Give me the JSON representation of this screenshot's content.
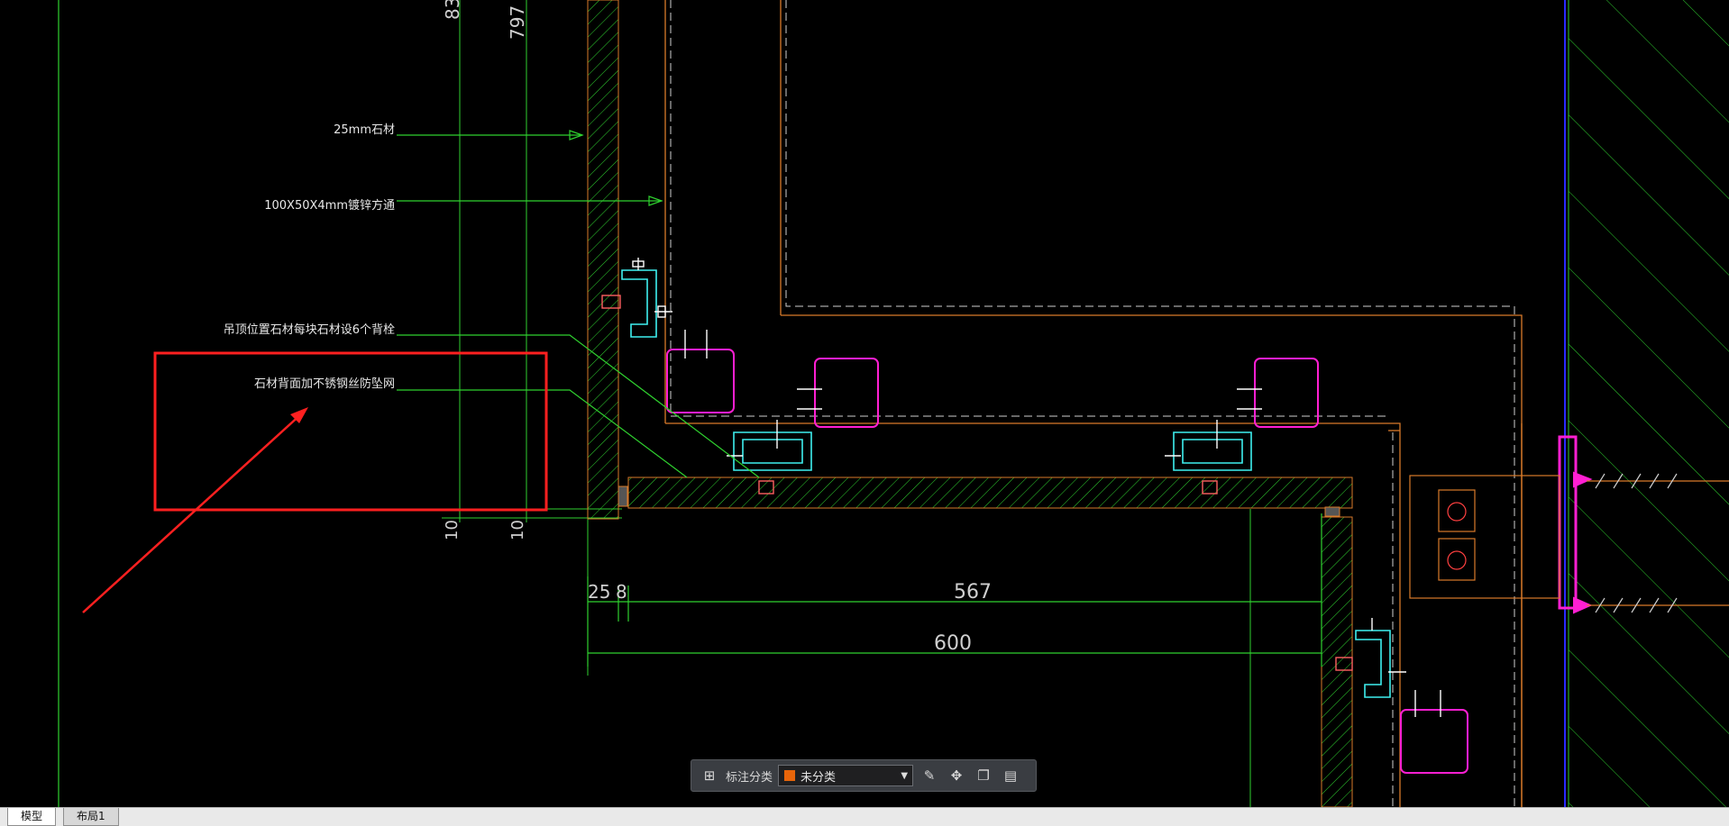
{
  "drawing": {
    "dim_top_a": "83",
    "dim_top_b": "797",
    "dim_10_a": "10",
    "dim_10_b": "10",
    "dim_25": "25",
    "dim_8": "8",
    "dim_567": "567",
    "dim_600": "600",
    "label_stone": "25mm石材",
    "label_tube": "100X50X4mm镀锌方通",
    "label_bolt": "吊顶位置石材每块石材设6个背栓",
    "label_mesh": "石材背面加不锈钢丝防坠网",
    "colors": {
      "dimension": "#2fd12f",
      "frame": "#d97a2a",
      "magenta": "#ff1fd2",
      "cyan": "#3ff0f0",
      "highlight": "#ff2020",
      "axis": "#2a2aff"
    }
  },
  "toolbar": {
    "label": "标注分类",
    "select_value": "未分类"
  },
  "tabs": {
    "model": "模型",
    "layout1": "布局1"
  }
}
